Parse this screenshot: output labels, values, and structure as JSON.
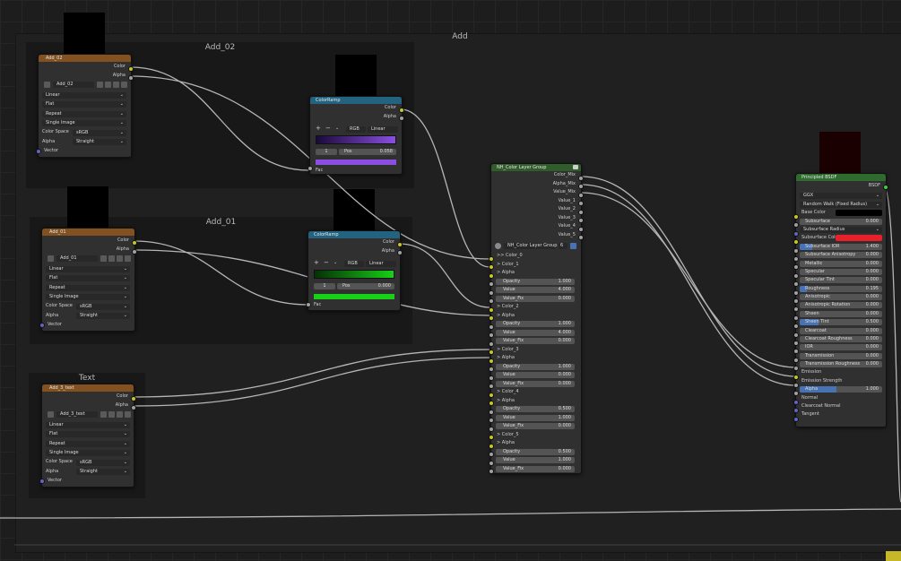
{
  "frames": {
    "add": "Add",
    "add02": "Add_02",
    "add01": "Add_01",
    "text": "Text"
  },
  "colors": {
    "texture_header": "#83501f",
    "converter_header": "#24637f",
    "group_header": "#2f5c2a",
    "shader_header": "#2f6a2f",
    "socket_color": "#c7c729",
    "socket_float": "#a1a1a1",
    "socket_vector": "#6363c7",
    "ramp_purple": "#8a4fe0",
    "ramp_green": "#17d017",
    "subsurface_red": "#e8202a"
  },
  "tex_nodes": [
    {
      "title": "Add_02",
      "color_out": "Color",
      "alpha_out": "Alpha",
      "image": "Add_02",
      "interpolation": "Linear",
      "projection": "Flat",
      "extension": "Repeat",
      "source": "Single Image",
      "colorspace_label": "Color Space",
      "colorspace": "sRGB",
      "alpha_label": "Alpha",
      "alpha": "Straight",
      "vector": "Vector"
    },
    {
      "title": "Add_01",
      "color_out": "Color",
      "alpha_out": "Alpha",
      "image": "Add_01",
      "interpolation": "Linear",
      "projection": "Flat",
      "extension": "Repeat",
      "source": "Single Image",
      "colorspace_label": "Color Space",
      "colorspace": "sRGB",
      "alpha_label": "Alpha",
      "alpha": "Straight",
      "vector": "Vector"
    },
    {
      "title": "Add_3_text",
      "color_out": "Color",
      "alpha_out": "Alpha",
      "image": "Add_3_text",
      "interpolation": "Linear",
      "projection": "Flat",
      "extension": "Repeat",
      "source": "Single Image",
      "colorspace_label": "Color Space",
      "colorspace": "sRGB",
      "alpha_label": "Alpha",
      "alpha": "Straight",
      "vector": "Vector"
    }
  ],
  "ramps": [
    {
      "title": "ColorRamp",
      "color_out": "Color",
      "alpha_out": "Alpha",
      "mode": "RGB",
      "interp": "Linear",
      "index": "1",
      "pos_label": "Pos",
      "pos": "0.058",
      "fac": "Fac"
    },
    {
      "title": "ColorRamp",
      "color_out": "Color",
      "alpha_out": "Alpha",
      "mode": "RGB",
      "interp": "Linear",
      "index": "1",
      "pos_label": "Pos",
      "pos": "0.000",
      "fac": "Fac"
    }
  ],
  "group": {
    "title": "NH_Color Layer Group",
    "outputs": [
      "Color_Mix",
      "Alpha_Mix",
      "Value_Mix",
      "Value_1",
      "Value_2",
      "Value_3",
      "Value_4",
      "Value_5"
    ],
    "datablock": "NH_Color Layer Group",
    "users": "6",
    "inputs": [
      {
        "kind": "label",
        "text": ">> Color_0"
      },
      {
        "kind": "label",
        "text": "> Color_1"
      },
      {
        "kind": "label",
        "text": "> Alpha"
      },
      {
        "kind": "field",
        "text": "Opacity",
        "value": "1.000"
      },
      {
        "kind": "field",
        "text": "Value",
        "value": "4.000"
      },
      {
        "kind": "field",
        "text": "Value_Fix",
        "value": "0.000"
      },
      {
        "kind": "label",
        "text": "> Color_2"
      },
      {
        "kind": "label",
        "text": "> Alpha"
      },
      {
        "kind": "field",
        "text": "Opacity",
        "value": "1.000"
      },
      {
        "kind": "field",
        "text": "Value",
        "value": "4.000"
      },
      {
        "kind": "field",
        "text": "Value_Fix",
        "value": "0.000"
      },
      {
        "kind": "label",
        "text": "> Color_3"
      },
      {
        "kind": "label",
        "text": "> Alpha"
      },
      {
        "kind": "field",
        "text": "Opacity",
        "value": "1.000"
      },
      {
        "kind": "field",
        "text": "Value",
        "value": "0.000"
      },
      {
        "kind": "field",
        "text": "Value_Fix",
        "value": "0.000"
      },
      {
        "kind": "label",
        "text": "> Color_4"
      },
      {
        "kind": "label",
        "text": "> Alpha"
      },
      {
        "kind": "field",
        "text": "Opacity",
        "value": "0.500"
      },
      {
        "kind": "field",
        "text": "Value",
        "value": "1.000"
      },
      {
        "kind": "field",
        "text": "Value_Fix",
        "value": "0.000"
      },
      {
        "kind": "label",
        "text": "> Color_5"
      },
      {
        "kind": "label",
        "text": "> Alpha"
      },
      {
        "kind": "field",
        "text": "Opacity",
        "value": "0.500"
      },
      {
        "kind": "field",
        "text": "Value",
        "value": "1.000"
      },
      {
        "kind": "field",
        "text": "Value_Fix",
        "value": "0.000"
      }
    ]
  },
  "bsdf": {
    "title": "Principled BSDF",
    "out": "BSDF",
    "distribution": "GGX",
    "subsurface_method": "Random Walk (Fixed Radius)",
    "rows": [
      {
        "kind": "color",
        "text": "Base Color",
        "swatch": "#000000"
      },
      {
        "kind": "field",
        "text": "Subsurface",
        "value": "0.000"
      },
      {
        "kind": "dd",
        "text": "Subsurface Radius"
      },
      {
        "kind": "color",
        "text": "Subsurface Color",
        "swatch": "#e8202a"
      },
      {
        "kind": "slider",
        "text": "Subsurface IOR",
        "value": "1.400",
        "fill": 0.35
      },
      {
        "kind": "field",
        "text": "Subsurface Anisotropy",
        "value": "0.000"
      },
      {
        "kind": "field",
        "text": "Metallic",
        "value": "0.000"
      },
      {
        "kind": "field",
        "text": "Specular",
        "value": "0.000"
      },
      {
        "kind": "field",
        "text": "Specular Tint",
        "value": "0.000"
      },
      {
        "kind": "slider",
        "text": "Roughness",
        "value": "0.195",
        "fill": 0.2
      },
      {
        "kind": "field",
        "text": "Anisotropic",
        "value": "0.000"
      },
      {
        "kind": "field",
        "text": "Anisotropic Rotation",
        "value": "0.000"
      },
      {
        "kind": "field",
        "text": "Sheen",
        "value": "0.000"
      },
      {
        "kind": "slider",
        "text": "Sheen Tint",
        "value": "0.500",
        "fill": 0.5
      },
      {
        "kind": "field",
        "text": "Clearcoat",
        "value": "0.000"
      },
      {
        "kind": "field",
        "text": "Clearcoat Roughness",
        "value": "0.000"
      },
      {
        "kind": "field",
        "text": "IOR",
        "value": "0.000"
      },
      {
        "kind": "field",
        "text": "Transmission",
        "value": "0.000"
      },
      {
        "kind": "field",
        "text": "Transmission Roughness",
        "value": "0.000"
      },
      {
        "kind": "label",
        "text": "Emission"
      },
      {
        "kind": "label",
        "text": "Emission Strength"
      },
      {
        "kind": "slider",
        "text": "Alpha",
        "value": "1.000",
        "fill": 1.0
      },
      {
        "kind": "label",
        "text": "Normal"
      },
      {
        "kind": "label",
        "text": "Clearcoat Normal"
      },
      {
        "kind": "label",
        "text": "Tangent"
      }
    ]
  }
}
